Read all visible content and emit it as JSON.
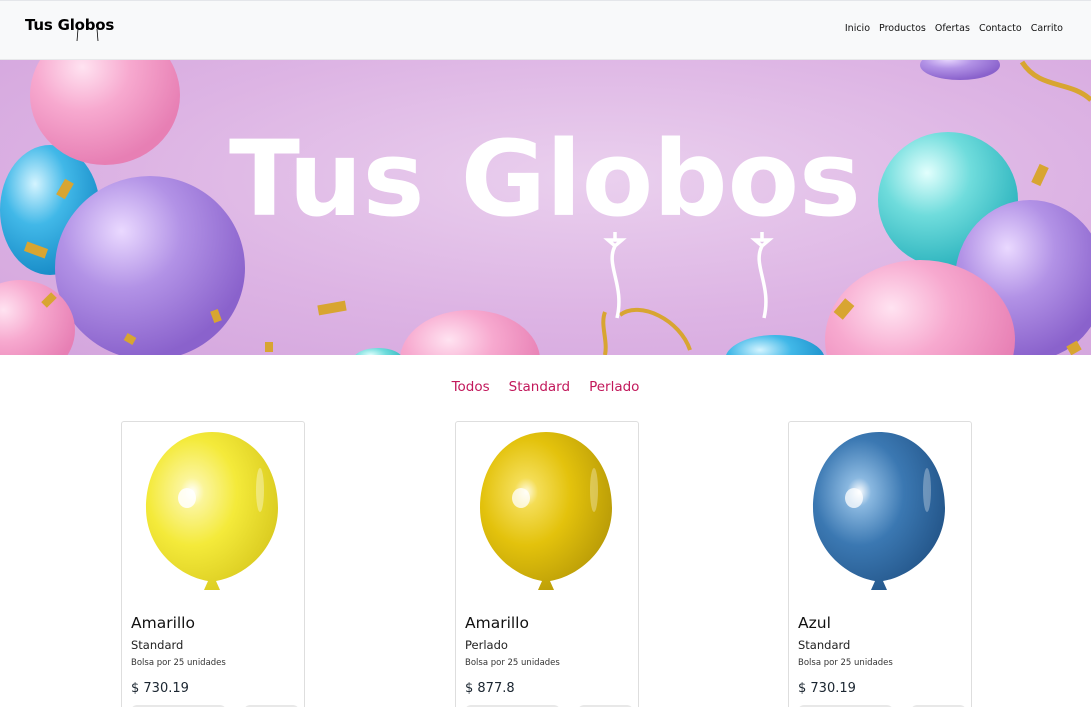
{
  "brand": {
    "name": "Tus Globos"
  },
  "nav": {
    "links": [
      "Inicio",
      "Productos",
      "Ofertas",
      "Contacto",
      "Carrito"
    ]
  },
  "hero": {
    "title": "Tus Globos",
    "colors": {
      "background": "#ddb4e4",
      "pink": "#f3a8cc",
      "purple": "#a47fd9",
      "teal": "#5fd4d6",
      "blue": "#3ab0e0",
      "gold": "#d8a531"
    }
  },
  "filters": [
    "Todos",
    "Standard",
    "Perlado"
  ],
  "accent_color": "#c2185b",
  "products": [
    {
      "name": "Amarillo",
      "type": "Standard",
      "desc": "Bolsa por 25 unidades",
      "price": "$ 730.19",
      "color": "#f4ea3a"
    },
    {
      "name": "Amarillo",
      "type": "Perlado",
      "desc": "Bolsa por 25 unidades",
      "price": "$ 877.8",
      "color": "#e3c20c"
    },
    {
      "name": "Azul",
      "type": "Standard",
      "desc": "Bolsa por 25 unidades",
      "price": "$ 730.19",
      "color": "#3b78b2"
    }
  ]
}
